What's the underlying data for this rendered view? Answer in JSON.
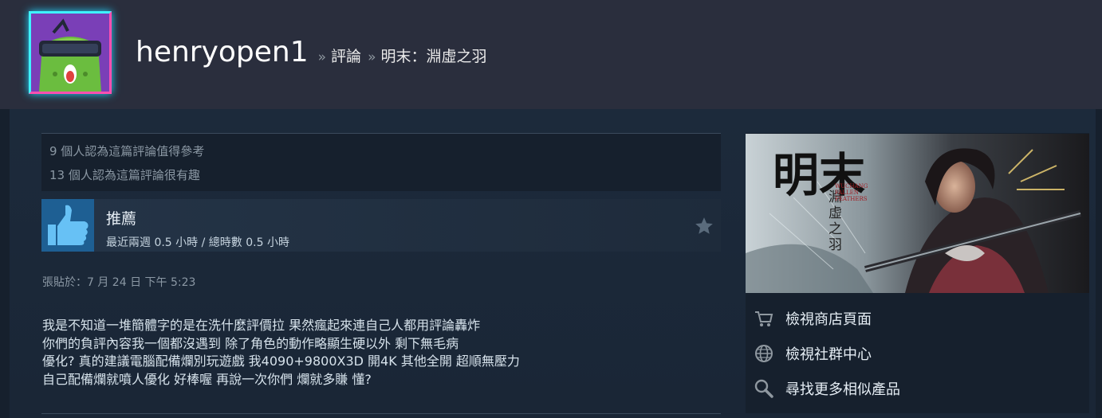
{
  "header": {
    "username": "henryopen1",
    "sep1": "»",
    "crumb_reviews": "評論",
    "sep2": "»",
    "crumb_game": "明末：淵虛之羽",
    "avatar_icon": "alien-vr-headset-avatar"
  },
  "ratings": {
    "helpful": "9 個人認為這篇評論值得參考",
    "funny": "13 個人認為這篇評論很有趣"
  },
  "recommendation": {
    "title": "推薦",
    "hours": "最近兩週 0.5 小時 / 總時數 0.5 小時",
    "icon": "thumbs-up-icon",
    "award_icon": "star-icon"
  },
  "posted": "張貼於：7 月 24 日 下午 5:23",
  "review_lines": [
    "我是不知道一堆簡體字的是在洗什麼評價拉 果然瘋起來連自己人都用評論轟炸",
    "你們的負評內容我一個都沒遇到 除了角色的動作略顯生硬以外 剩下無毛病",
    "優化? 真的建議電腦配備爛別玩遊戲 我4090+9800X3D 開4K 其他全開 超順無壓力",
    "自己配備爛就噴人優化 好棒喔 再說一次你們 爛就多賺 懂?"
  ],
  "side": {
    "capsule_title_main": "明末",
    "capsule_title_sub": "淵虛之羽",
    "capsule_en": "WUCHANG\nFALLEN\nFEATHERS",
    "links": [
      {
        "label": "檢視商店頁面",
        "icon": "cart-icon"
      },
      {
        "label": "檢視社群中心",
        "icon": "globe-icon"
      },
      {
        "label": "尋找更多相似產品",
        "icon": "magnifier-icon"
      }
    ]
  },
  "colors": {
    "background": "#1b2838",
    "header": "#2a2e3d",
    "thumb": "#1e5f93",
    "accent_cyan": "#3ff3ff",
    "accent_pink": "#ff4fb0"
  }
}
